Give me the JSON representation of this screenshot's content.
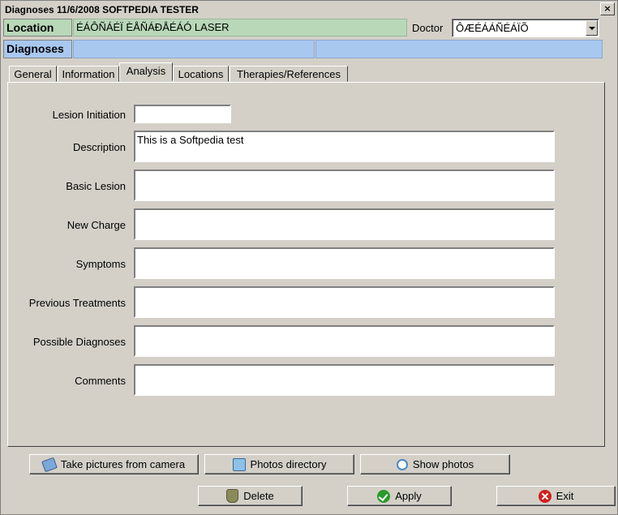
{
  "window": {
    "title": "Diagnoses 11/6/2008 SOFTPEDIA TESTER",
    "close_symbol": "×"
  },
  "header": {
    "location_label": "Location",
    "location_value": "ÉÁÔÑÁÉÏ ÈÅÑÁÐÅÉÁÓ LASER",
    "doctor_label": "Doctor",
    "doctor_value": "ÔÆÉÁÁÑÉÁÏÕ",
    "diagnoses_label": "Diagnoses",
    "diagnoses_value_1": "",
    "diagnoses_value_2": ""
  },
  "tabs": [
    {
      "label": "General"
    },
    {
      "label": "Information"
    },
    {
      "label": "Analysis"
    },
    {
      "label": "Locations"
    },
    {
      "label": "Therapies/References"
    }
  ],
  "form": {
    "lesion_initiation": {
      "label": "Lesion Initiation",
      "value": ""
    },
    "description": {
      "label": "Description",
      "value": "This is a Softpedia test"
    },
    "basic_lesion": {
      "label": "Basic Lesion",
      "value": ""
    },
    "new_charge": {
      "label": "New Charge",
      "value": ""
    },
    "symptoms": {
      "label": "Symptoms",
      "value": ""
    },
    "previous_treatments": {
      "label": "Previous Treatments",
      "value": ""
    },
    "possible_diagnoses": {
      "label": "Possible Diagnoses",
      "value": ""
    },
    "comments": {
      "label": "Comments",
      "value": ""
    }
  },
  "buttons": {
    "take_pictures": "Take pictures from camera",
    "photos_directory": "Photos directory",
    "show_photos": "Show photos",
    "delete": "Delete",
    "apply": "Apply",
    "exit": "Exit"
  },
  "colors": {
    "location_bg": "#b8d8b8",
    "diagnoses_bg": "#a8c8f0",
    "apply_icon": "#2a9a2a",
    "exit_icon": "#d02020"
  }
}
